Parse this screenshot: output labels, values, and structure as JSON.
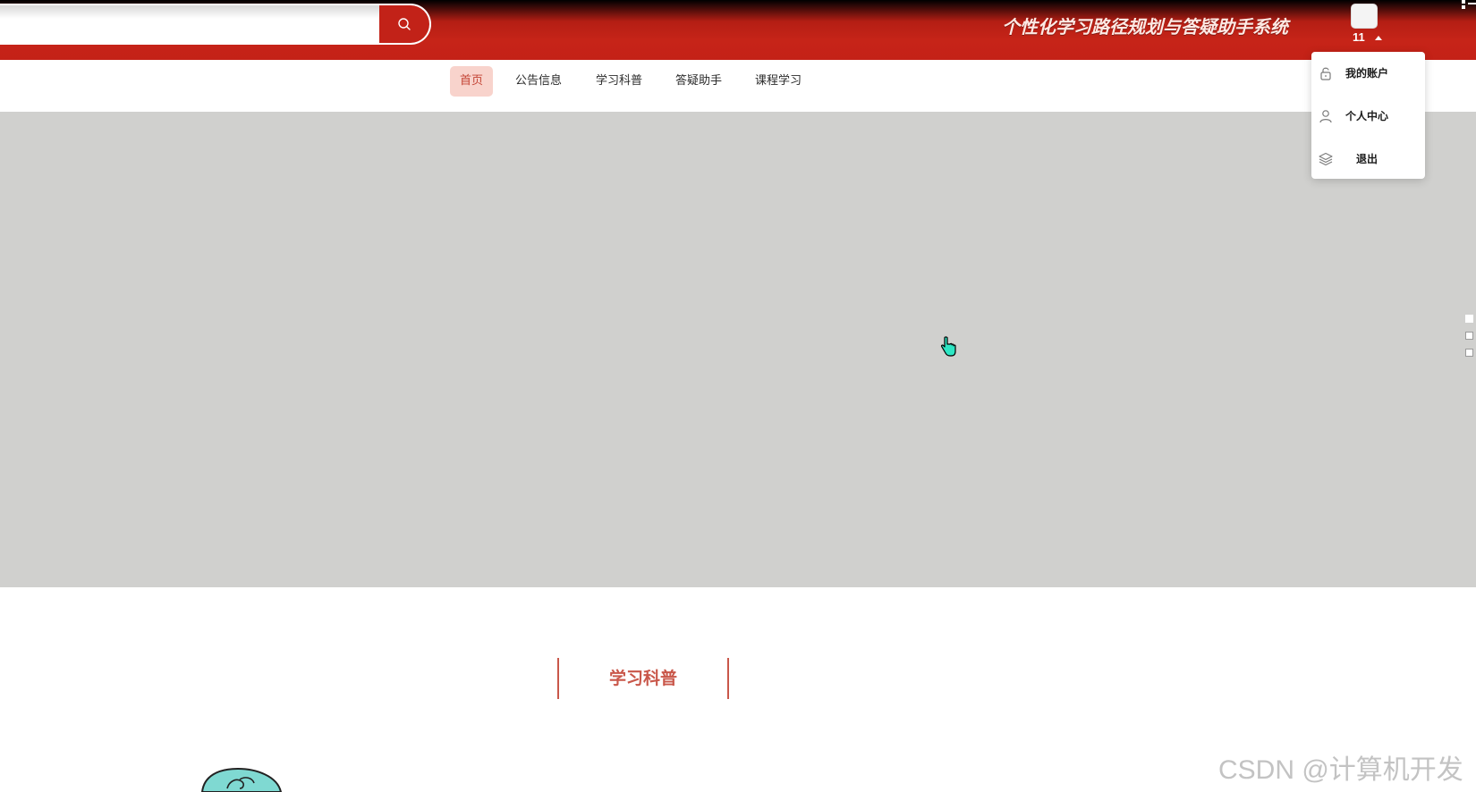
{
  "header": {
    "search_placeholder": "",
    "site_title": "个性化学习路径规划与答疑助手系统",
    "username": "11"
  },
  "nav": {
    "items": [
      {
        "label": "首页",
        "active": true
      },
      {
        "label": "公告信息",
        "active": false
      },
      {
        "label": "学习科普",
        "active": false
      },
      {
        "label": "答疑助手",
        "active": false
      },
      {
        "label": "课程学习",
        "active": false
      }
    ]
  },
  "user_menu": {
    "items": [
      {
        "label": "我的账户",
        "icon": "lock-icon"
      },
      {
        "label": "个人中心",
        "icon": "user-icon"
      },
      {
        "label": "退出",
        "icon": "layers-icon"
      }
    ]
  },
  "section": {
    "title": "学习科普"
  },
  "watermark": "CSDN @计算机开发",
  "colors": {
    "header_red": "#c42117",
    "nav_active_bg": "#f8d3cc",
    "accent": "#c9574a",
    "banner_bg": "#d0d0ce"
  }
}
